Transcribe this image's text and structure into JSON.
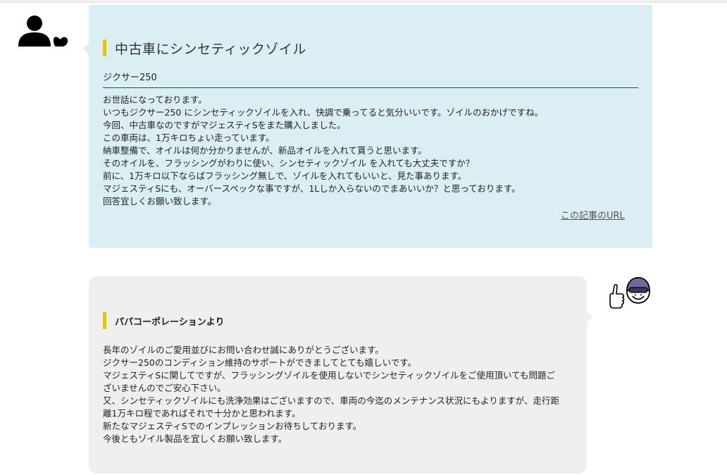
{
  "top_fragment": "· · · · · ·",
  "question": {
    "title": "中古車にシンセティックゾイル",
    "model": "ジクサー250",
    "body": [
      "お世話になっております。",
      "いつもジクサー250 にシンセティックゾイルを入れ、快調で乗ってると気分いいです。ゾイルのおかげですね。",
      "今回、中古車なのですがマジェスティSをまた購入しました。",
      "この車両は、1万キロちょい走っています。",
      "納車整備で、オイルは何か分かりませんが、新品オイルを入れて貰うと思います。",
      "そのオイルを、フラッシングがわりに使い、シンセティックゾイル を入れても大丈夫ですか？",
      "前に、1万キロ以下ならばフラッシング無しで、ゾイルを入れてもいいと、見た事あります。",
      "マジェスティSにも、オーバースペックな事ですが、1Lしか入らないのでまあいいか？と思っております。",
      "回答宜しくお願い致します。"
    ],
    "link_label": "この記事のURL"
  },
  "answer": {
    "title": "パパコーポレーションより",
    "body": [
      "長年のゾイルのご愛用並びにお問い合わせ誠にありがとうございます。",
      "ジクサー250のコンディション維持のサポートができましてとても嬉しいです。",
      "マジェスティSに関してですが、フラッシングゾイルを使用しないでシンセティックゾイルをご使用頂いても問題ご",
      "ざいませんのでご安心下さい。",
      "又、シンセティックゾイルにも洗浄効果はございますので、車両の今迄のメンテナンス状況にもよりますが、走行距",
      "離1万キロ程であればそれで十分かと思われます。",
      "新たなマジェスティSでのインプレッションお待ちしております。",
      "今後ともゾイル製品を宜しくお願い致します。"
    ]
  },
  "colors": {
    "question_bg": "#daeef4",
    "answer_bg": "#efefef",
    "accent_bar": "#e2c400",
    "helmet": "#6b6b9e"
  },
  "icons": {
    "user": "user-silhouette-icon",
    "staff": "staff-helmet-thumbsup-icon"
  }
}
